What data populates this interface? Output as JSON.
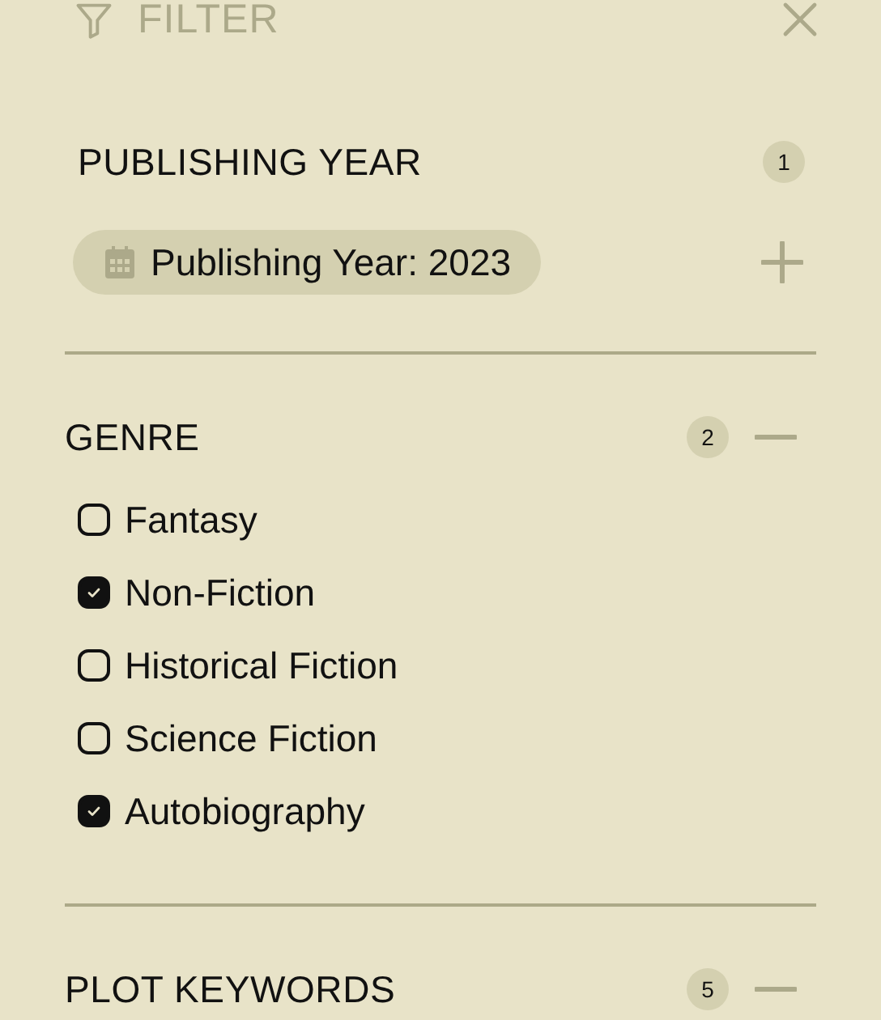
{
  "header": {
    "title": "FILTER"
  },
  "sections": [
    {
      "kind": "chips",
      "title": "PUBLISHING YEAR",
      "count": "1",
      "chips": [
        "Publishing Year: 2023"
      ]
    },
    {
      "kind": "checklist",
      "title": "GENRE",
      "count": "2",
      "expanded": true,
      "items": [
        {
          "label": "Fantasy",
          "checked": false
        },
        {
          "label": "Non-Fiction",
          "checked": true
        },
        {
          "label": "Historical Fiction",
          "checked": false
        },
        {
          "label": "Science Fiction",
          "checked": false
        },
        {
          "label": "Autobiography",
          "checked": true
        }
      ]
    },
    {
      "kind": "checklist",
      "title": "PLOT KEYWORDS",
      "count": "5",
      "expanded": true
    }
  ]
}
